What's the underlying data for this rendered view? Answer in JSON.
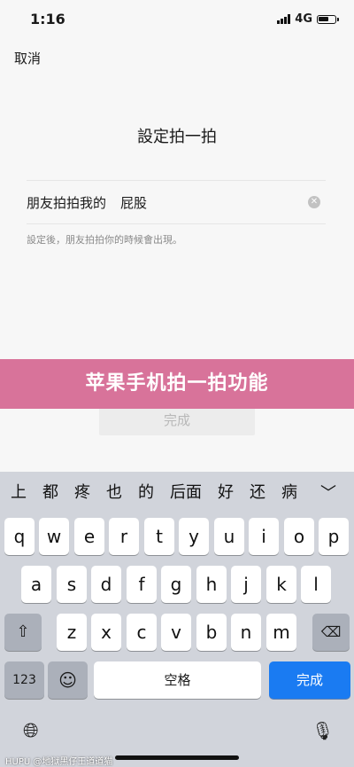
{
  "status_bar": {
    "time": "1:16",
    "network": "4G"
  },
  "header": {
    "cancel_label": "取消",
    "title": "設定拍一拍"
  },
  "form": {
    "label": "朋友拍拍我的",
    "value": "屁股",
    "hint": "設定後，朋友拍拍你的時候會出現。"
  },
  "banner": {
    "text": "苹果手机拍一拍功能"
  },
  "done_button": {
    "label": "完成"
  },
  "candidates": [
    "上",
    "都",
    "疼",
    "也",
    "的",
    "后面",
    "好",
    "还",
    "病"
  ],
  "keyboard": {
    "row1": [
      "q",
      "w",
      "e",
      "r",
      "t",
      "y",
      "u",
      "i",
      "o",
      "p"
    ],
    "row2": [
      "a",
      "s",
      "d",
      "f",
      "g",
      "h",
      "j",
      "k",
      "l"
    ],
    "row3": [
      "z",
      "x",
      "c",
      "v",
      "b",
      "n",
      "m"
    ],
    "numbers_label": "123",
    "space_label": "空格",
    "return_label": "完成"
  },
  "watermark": {
    "text": "HUPU @地狱黑仔王道道猫"
  },
  "colors": {
    "banner": "#d8739a",
    "return_key": "#1a7bf2"
  }
}
